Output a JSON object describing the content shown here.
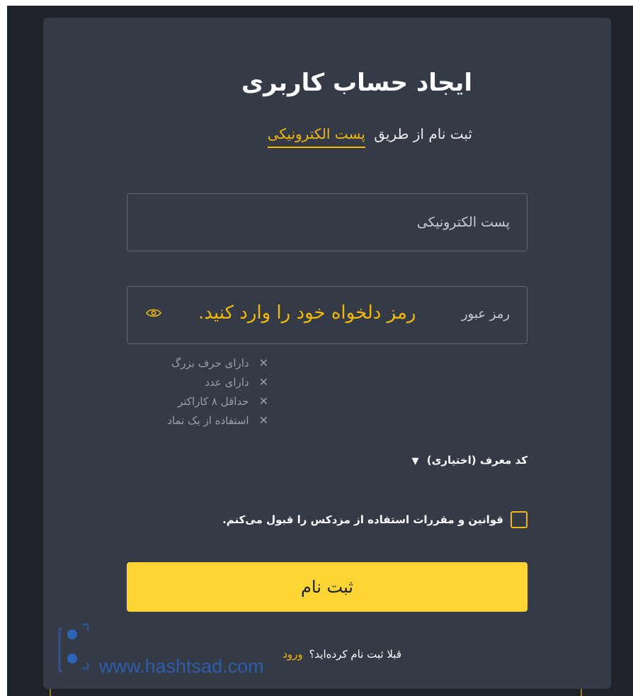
{
  "page": {
    "title": "ایجاد حساب کاربری",
    "subtitle_prefix": "ثبت نام از طریق",
    "subtitle_link": "پست الکترونیکی"
  },
  "form": {
    "email_placeholder": "پست الکترونیکی",
    "password_label": "رمز عبور",
    "password_hint": "رمز دلخواه خود را وارد کنید."
  },
  "password_rules": [
    "دارای حرف بزرگ",
    "دارای عدد",
    "حداقل ۸ کاراکتر",
    "استفاده از یک نماد"
  ],
  "referral": {
    "label": "کد معرف (اختیاری)",
    "toggle_symbol": "▼"
  },
  "terms": {
    "text": "قوانین و مقررات استفاده از مزدکس را قبول می‌کنم."
  },
  "submit_label": "ثبت نام",
  "login_prompt": {
    "text": "قبلا ثبت نام کرده‌اید؟",
    "link": "ورود"
  },
  "watermark": "www.hashtsad.com",
  "colors": {
    "accent": "#f0b90b",
    "button": "#fcd535",
    "card": "#343a46",
    "background": "#1e2329"
  }
}
